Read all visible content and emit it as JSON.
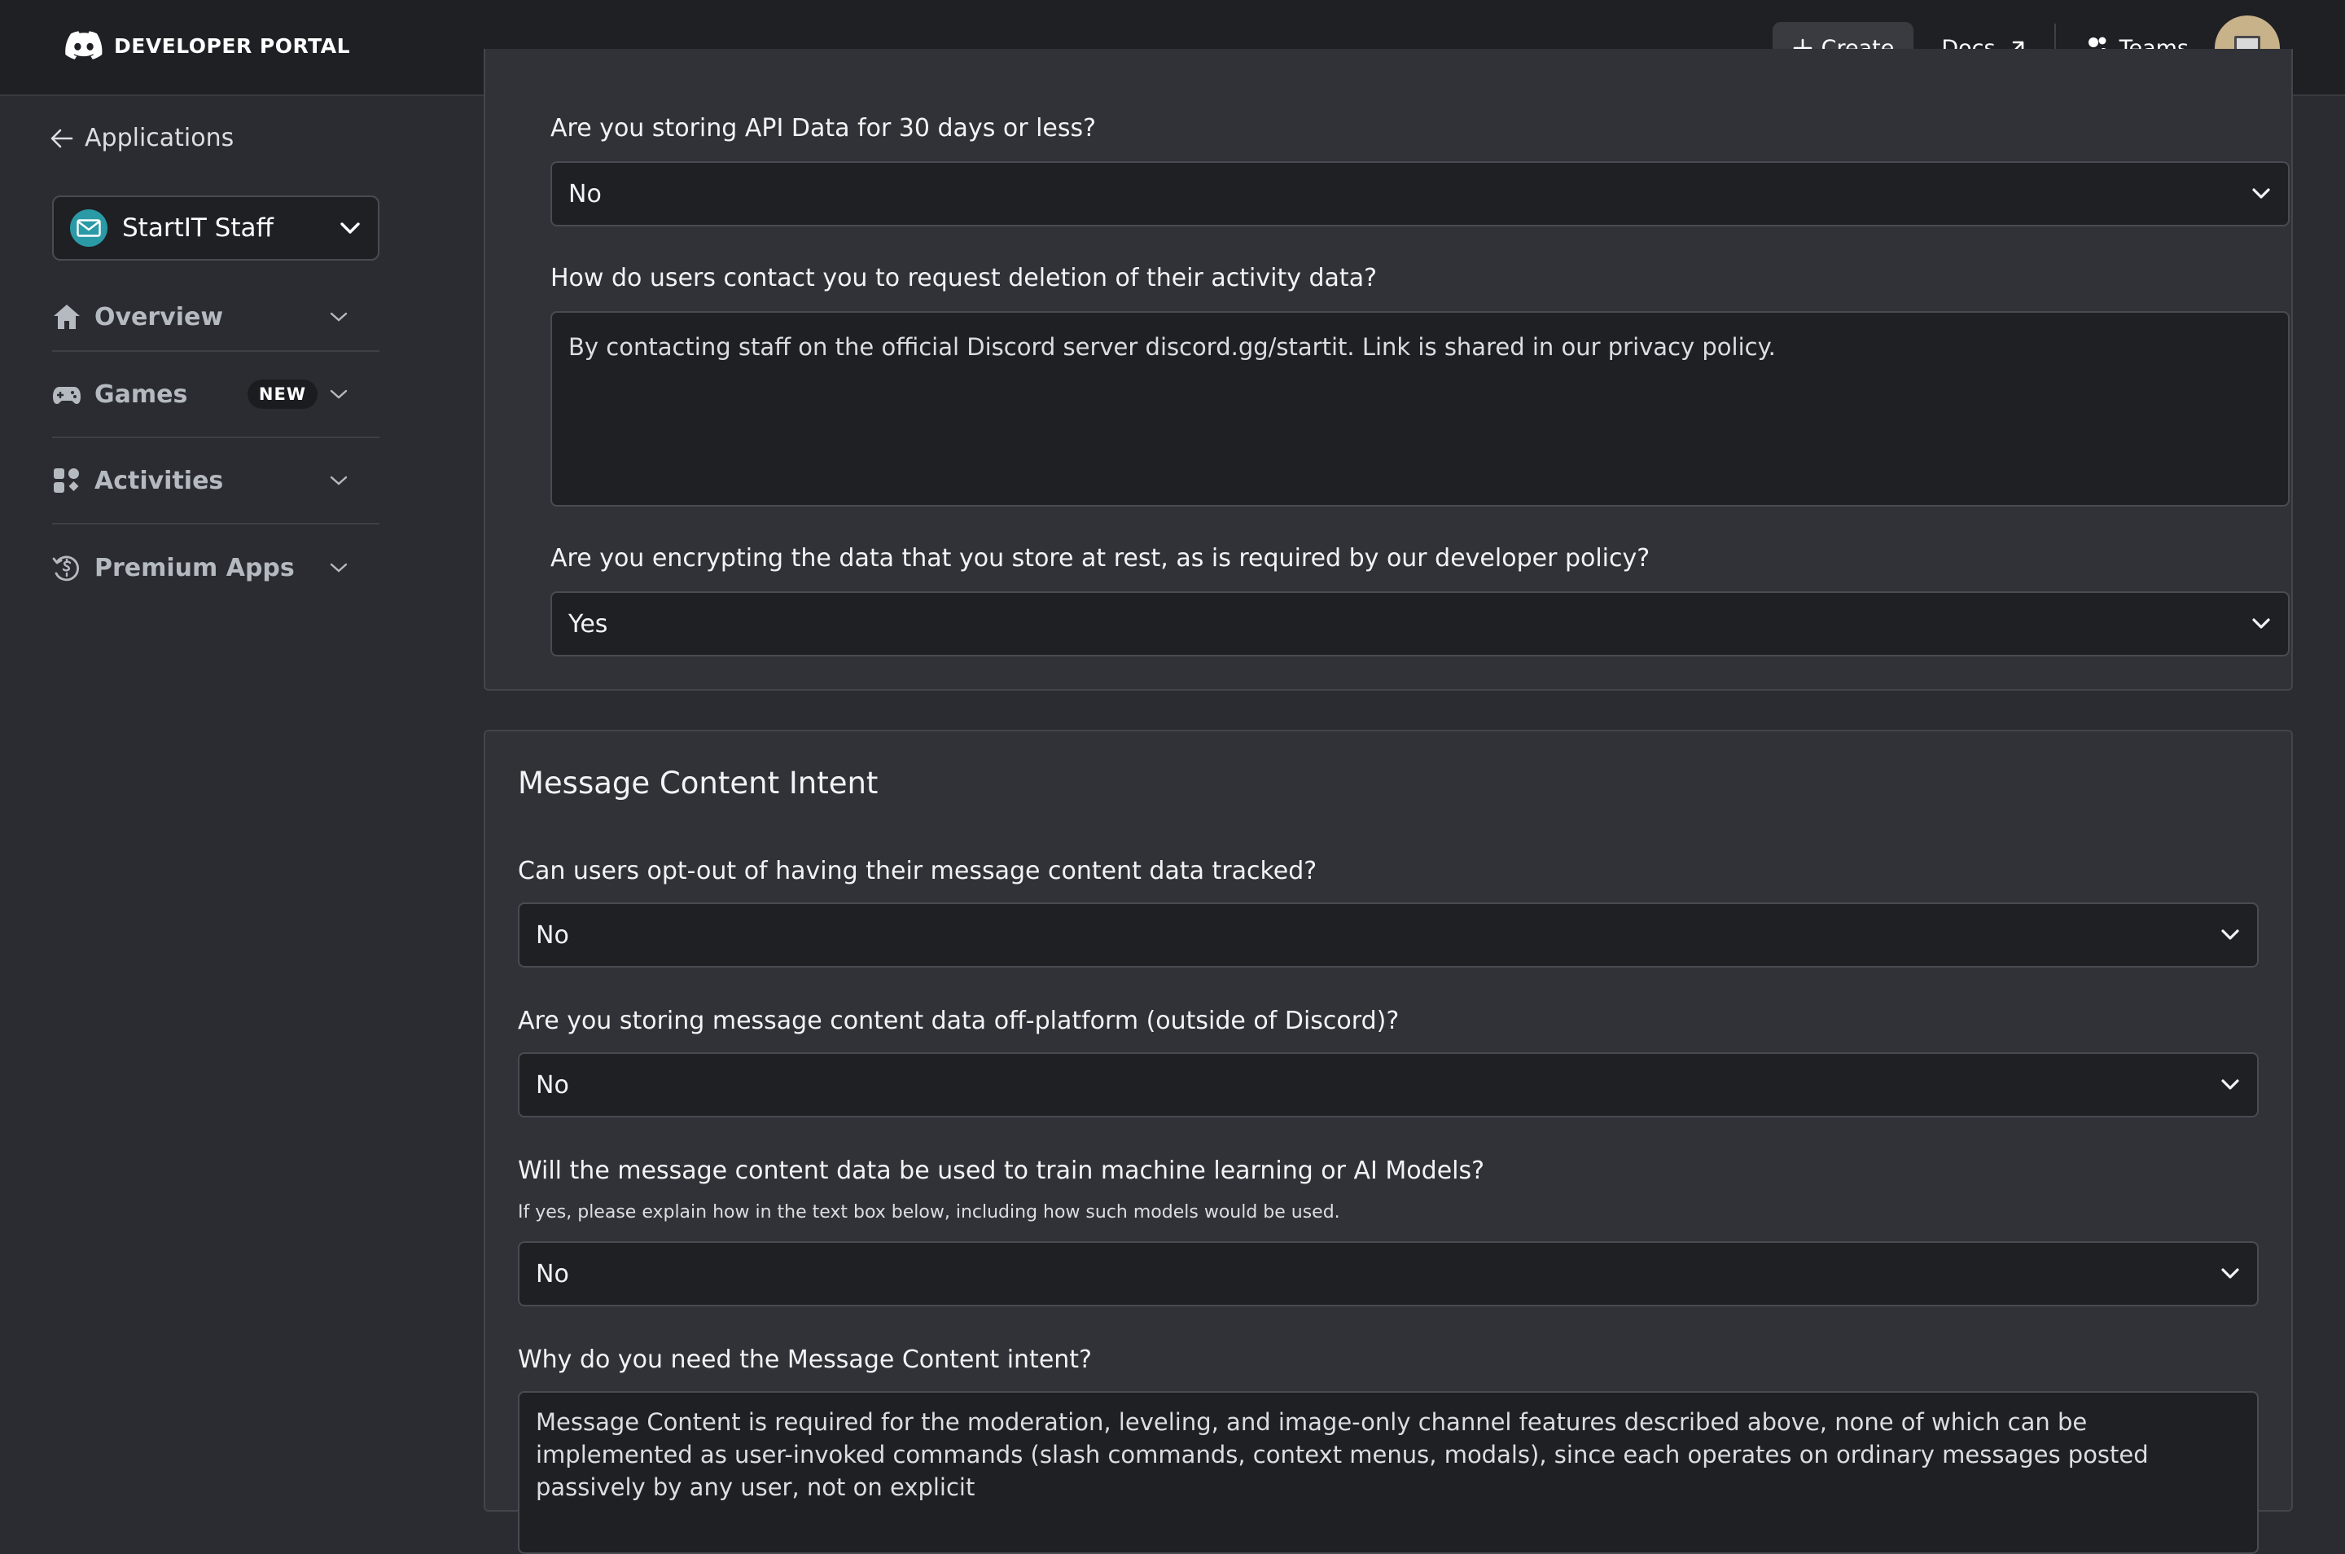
{
  "header": {
    "brand": "DEVELOPER PORTAL",
    "create_label": "Create",
    "docs_label": "Docs",
    "teams_label": "Teams"
  },
  "sidebar": {
    "back_label": "Applications",
    "app_name": "StartIT Staff",
    "items": [
      {
        "label": "Overview",
        "icon": "home-icon"
      },
      {
        "label": "Games",
        "icon": "gamepad-icon",
        "badge": "NEW"
      },
      {
        "label": "Activities",
        "icon": "activities-icon"
      },
      {
        "label": "Premium Apps",
        "icon": "premium-icon"
      }
    ]
  },
  "data_section": {
    "q_storing_30_days": "Are you storing API Data for 30 days or less?",
    "a_storing_30_days": "No",
    "q_contact_deletion": "How do users contact you to request deletion of their activity data?",
    "a_contact_deletion": "By contacting staff on the official Discord server discord.gg/startit. Link is shared in our privacy policy.",
    "q_encrypting": "Are you encrypting the data that you store at rest, as is required by our developer policy?",
    "a_encrypting": "Yes"
  },
  "message_content": {
    "title": "Message Content Intent",
    "q_opt_out": "Can users opt-out of having their message content data tracked?",
    "a_opt_out": "No",
    "q_off_platform": "Are you storing message content data off-platform (outside of Discord)?",
    "a_off_platform": "No",
    "q_train_ml": "Will the message content data be used to train machine learning or AI Models?",
    "h_train_ml": "If yes, please explain how in the text box below, including how such models would be used.",
    "a_train_ml": "No",
    "q_why_need": "Why do you need the Message Content intent?",
    "a_why_need": "Message Content is required for the moderation, leveling, and image-only channel features described above, none of which can be implemented as user-invoked commands (slash commands, context menus, modals), since each operates on ordinary messages posted passively by any user, not on explicit"
  },
  "colors": {
    "background": "#2b2c31",
    "topbar": "#1f2024",
    "panel": "#313238",
    "app_icon": "#2a9aa6"
  }
}
